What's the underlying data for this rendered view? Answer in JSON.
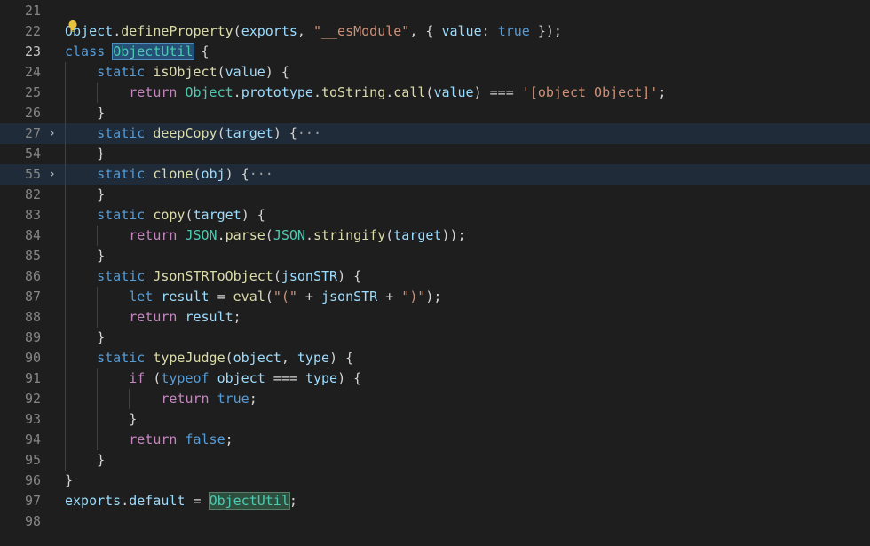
{
  "editor": {
    "lines": [
      {
        "num": "21",
        "tokens": []
      },
      {
        "num": "22",
        "tokens": [
          {
            "t": "Object",
            "c": "tk-var"
          },
          {
            "t": ".",
            "c": "tk-plain"
          },
          {
            "t": "defineProperty",
            "c": "tk-fn"
          },
          {
            "t": "(",
            "c": "tk-plain"
          },
          {
            "t": "exports",
            "c": "tk-var"
          },
          {
            "t": ", ",
            "c": "tk-plain"
          },
          {
            "t": "\"__esModule\"",
            "c": "tk-str"
          },
          {
            "t": ", { ",
            "c": "tk-plain"
          },
          {
            "t": "value",
            "c": "tk-var"
          },
          {
            "t": ": ",
            "c": "tk-plain"
          },
          {
            "t": "true",
            "c": "tk-kw"
          },
          {
            "t": " });",
            "c": "tk-plain"
          }
        ]
      },
      {
        "num": "23",
        "current": true,
        "tokens": [
          {
            "t": "class ",
            "c": "tk-kw"
          },
          {
            "t": "ObjectUtil",
            "c": "tk-type sel-occ"
          },
          {
            "t": " {",
            "c": "tk-plain"
          }
        ]
      },
      {
        "num": "24",
        "indent": 1,
        "tokens": [
          {
            "t": "static ",
            "c": "tk-kw"
          },
          {
            "t": "isObject",
            "c": "tk-fn"
          },
          {
            "t": "(",
            "c": "tk-plain"
          },
          {
            "t": "value",
            "c": "tk-var"
          },
          {
            "t": ") {",
            "c": "tk-plain"
          }
        ]
      },
      {
        "num": "25",
        "indent": 2,
        "tokens": [
          {
            "t": "return ",
            "c": "tk-ret"
          },
          {
            "t": "Object",
            "c": "tk-type"
          },
          {
            "t": ".",
            "c": "tk-plain"
          },
          {
            "t": "prototype",
            "c": "tk-var"
          },
          {
            "t": ".",
            "c": "tk-plain"
          },
          {
            "t": "toString",
            "c": "tk-fn"
          },
          {
            "t": ".",
            "c": "tk-plain"
          },
          {
            "t": "call",
            "c": "tk-fn"
          },
          {
            "t": "(",
            "c": "tk-plain"
          },
          {
            "t": "value",
            "c": "tk-var"
          },
          {
            "t": ") === ",
            "c": "tk-plain"
          },
          {
            "t": "'[object Object]'",
            "c": "tk-str"
          },
          {
            "t": ";",
            "c": "tk-plain"
          }
        ]
      },
      {
        "num": "26",
        "indent": 1,
        "tokens": [
          {
            "t": "}",
            "c": "tk-plain"
          }
        ]
      },
      {
        "num": "27",
        "indent": 1,
        "fold": "›",
        "highlighted": true,
        "tokens": [
          {
            "t": "static ",
            "c": "tk-kw"
          },
          {
            "t": "deepCopy",
            "c": "tk-fn"
          },
          {
            "t": "(",
            "c": "tk-plain"
          },
          {
            "t": "target",
            "c": "tk-var"
          },
          {
            "t": ") {",
            "c": "tk-plain"
          },
          {
            "t": "···",
            "c": "ellipsis-box"
          }
        ]
      },
      {
        "num": "54",
        "indent": 1,
        "tokens": [
          {
            "t": "}",
            "c": "tk-plain"
          }
        ]
      },
      {
        "num": "55",
        "indent": 1,
        "fold": "›",
        "highlighted": true,
        "tokens": [
          {
            "t": "static ",
            "c": "tk-kw"
          },
          {
            "t": "clone",
            "c": "tk-fn"
          },
          {
            "t": "(",
            "c": "tk-plain"
          },
          {
            "t": "obj",
            "c": "tk-var"
          },
          {
            "t": ") {",
            "c": "tk-plain"
          },
          {
            "t": "···",
            "c": "ellipsis-box"
          }
        ]
      },
      {
        "num": "82",
        "indent": 1,
        "tokens": [
          {
            "t": "}",
            "c": "tk-plain"
          }
        ]
      },
      {
        "num": "83",
        "indent": 1,
        "tokens": [
          {
            "t": "static ",
            "c": "tk-kw"
          },
          {
            "t": "copy",
            "c": "tk-fn"
          },
          {
            "t": "(",
            "c": "tk-plain"
          },
          {
            "t": "target",
            "c": "tk-var"
          },
          {
            "t": ") {",
            "c": "tk-plain"
          }
        ]
      },
      {
        "num": "84",
        "indent": 2,
        "tokens": [
          {
            "t": "return ",
            "c": "tk-ret"
          },
          {
            "t": "JSON",
            "c": "tk-type"
          },
          {
            "t": ".",
            "c": "tk-plain"
          },
          {
            "t": "parse",
            "c": "tk-fn"
          },
          {
            "t": "(",
            "c": "tk-plain"
          },
          {
            "t": "JSON",
            "c": "tk-type"
          },
          {
            "t": ".",
            "c": "tk-plain"
          },
          {
            "t": "stringify",
            "c": "tk-fn"
          },
          {
            "t": "(",
            "c": "tk-plain"
          },
          {
            "t": "target",
            "c": "tk-var"
          },
          {
            "t": "));",
            "c": "tk-plain"
          }
        ]
      },
      {
        "num": "85",
        "indent": 1,
        "tokens": [
          {
            "t": "}",
            "c": "tk-plain"
          }
        ]
      },
      {
        "num": "86",
        "indent": 1,
        "tokens": [
          {
            "t": "static ",
            "c": "tk-kw"
          },
          {
            "t": "JsonSTRToObject",
            "c": "tk-fn"
          },
          {
            "t": "(",
            "c": "tk-plain"
          },
          {
            "t": "jsonSTR",
            "c": "tk-var"
          },
          {
            "t": ") {",
            "c": "tk-plain"
          }
        ]
      },
      {
        "num": "87",
        "indent": 2,
        "tokens": [
          {
            "t": "let ",
            "c": "tk-kw"
          },
          {
            "t": "result",
            "c": "tk-var"
          },
          {
            "t": " = ",
            "c": "tk-plain"
          },
          {
            "t": "eval",
            "c": "tk-fn"
          },
          {
            "t": "(",
            "c": "tk-plain"
          },
          {
            "t": "\"(\"",
            "c": "tk-str"
          },
          {
            "t": " + ",
            "c": "tk-plain"
          },
          {
            "t": "jsonSTR",
            "c": "tk-var"
          },
          {
            "t": " + ",
            "c": "tk-plain"
          },
          {
            "t": "\")\"",
            "c": "tk-str"
          },
          {
            "t": ");",
            "c": "tk-plain"
          }
        ]
      },
      {
        "num": "88",
        "indent": 2,
        "tokens": [
          {
            "t": "return ",
            "c": "tk-ret"
          },
          {
            "t": "result",
            "c": "tk-var"
          },
          {
            "t": ";",
            "c": "tk-plain"
          }
        ]
      },
      {
        "num": "89",
        "indent": 1,
        "tokens": [
          {
            "t": "}",
            "c": "tk-plain"
          }
        ]
      },
      {
        "num": "90",
        "indent": 1,
        "tokens": [
          {
            "t": "static ",
            "c": "tk-kw"
          },
          {
            "t": "typeJudge",
            "c": "tk-fn"
          },
          {
            "t": "(",
            "c": "tk-plain"
          },
          {
            "t": "object",
            "c": "tk-var"
          },
          {
            "t": ", ",
            "c": "tk-plain"
          },
          {
            "t": "type",
            "c": "tk-var"
          },
          {
            "t": ") {",
            "c": "tk-plain"
          }
        ]
      },
      {
        "num": "91",
        "indent": 2,
        "tokens": [
          {
            "t": "if ",
            "c": "tk-ret"
          },
          {
            "t": "(",
            "c": "tk-plain"
          },
          {
            "t": "typeof ",
            "c": "tk-kw"
          },
          {
            "t": "object",
            "c": "tk-var"
          },
          {
            "t": " === ",
            "c": "tk-plain"
          },
          {
            "t": "type",
            "c": "tk-var"
          },
          {
            "t": ") {",
            "c": "tk-plain"
          }
        ]
      },
      {
        "num": "92",
        "indent": 3,
        "tokens": [
          {
            "t": "return ",
            "c": "tk-ret"
          },
          {
            "t": "true",
            "c": "tk-kw"
          },
          {
            "t": ";",
            "c": "tk-plain"
          }
        ]
      },
      {
        "num": "93",
        "indent": 2,
        "tokens": [
          {
            "t": "}",
            "c": "tk-plain"
          }
        ]
      },
      {
        "num": "94",
        "indent": 2,
        "tokens": [
          {
            "t": "return ",
            "c": "tk-ret"
          },
          {
            "t": "false",
            "c": "tk-kw"
          },
          {
            "t": ";",
            "c": "tk-plain"
          }
        ]
      },
      {
        "num": "95",
        "indent": 1,
        "tokens": [
          {
            "t": "}",
            "c": "tk-plain"
          }
        ]
      },
      {
        "num": "96",
        "tokens": [
          {
            "t": "}",
            "c": "tk-plain"
          }
        ]
      },
      {
        "num": "97",
        "tokens": [
          {
            "t": "exports",
            "c": "tk-var"
          },
          {
            "t": ".",
            "c": "tk-plain"
          },
          {
            "t": "default",
            "c": "tk-var"
          },
          {
            "t": " = ",
            "c": "tk-plain"
          },
          {
            "t": "ObjectUtil",
            "c": "tk-type sel-occ2"
          },
          {
            "t": ";",
            "c": "tk-plain"
          }
        ]
      },
      {
        "num": "98",
        "tokens": []
      }
    ]
  },
  "colors": {
    "background": "#1e1e1e",
    "line_number": "#858585",
    "highlight_line": "#1f2b38",
    "keyword": "#569cd6",
    "function": "#dcdcaa",
    "variable": "#9cdcfe",
    "type": "#4ec9b0",
    "string": "#ce9178",
    "control": "#c586c0"
  },
  "icons": {
    "lightbulb": "lightbulb-icon",
    "fold": "chevron-right-icon"
  }
}
